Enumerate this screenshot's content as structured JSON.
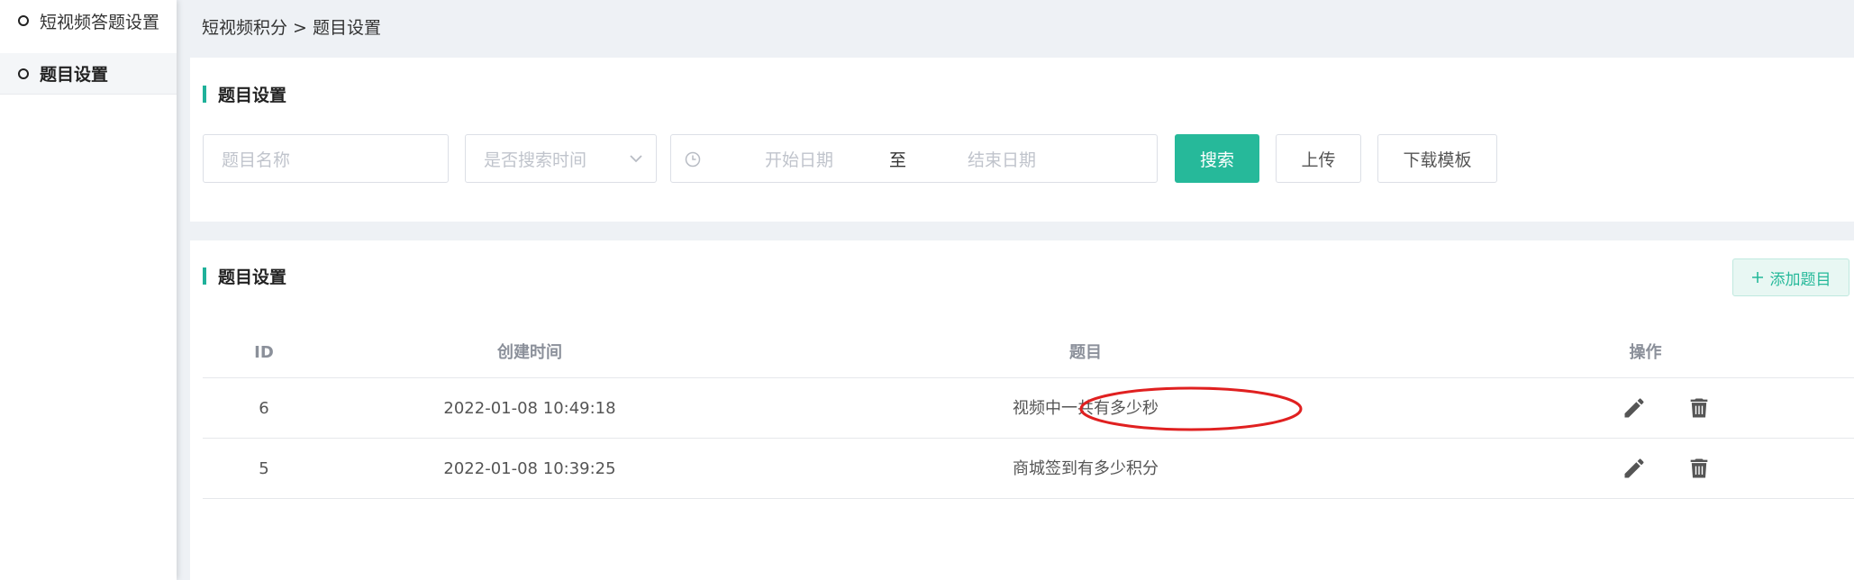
{
  "sidebar": {
    "items": [
      {
        "label": "短视频答题设置",
        "active": false
      },
      {
        "label": "题目设置",
        "active": true
      }
    ]
  },
  "breadcrumb": {
    "text": "短视频积分 > 题目设置"
  },
  "search_card": {
    "title": "题目设置",
    "name_input_placeholder": "题目名称",
    "time_select_placeholder": "是否搜索时间",
    "date_range": {
      "start_placeholder": "开始日期",
      "separator": "至",
      "end_placeholder": "结束日期"
    },
    "search_button": "搜索",
    "upload_button": "上传",
    "download_button": "下载模板"
  },
  "list_card": {
    "title": "题目设置",
    "add_button": "添加题目",
    "columns": [
      "ID",
      "创建时间",
      "题目",
      "操作"
    ],
    "rows": [
      {
        "id": "6",
        "created": "2022-01-08 10:49:18",
        "question": "视频中一共有多少秒",
        "highlighted": true
      },
      {
        "id": "5",
        "created": "2022-01-08 10:39:25",
        "question": "商城签到有多少积分",
        "highlighted": false
      }
    ]
  },
  "colors": {
    "accent": "#26b99a",
    "highlight_ring": "#e02020"
  },
  "icons": {
    "edit": "pencil-icon",
    "delete": "trash-icon",
    "clock": "clock-icon",
    "add": "plus-icon",
    "dropdown": "chevron-down-icon"
  }
}
